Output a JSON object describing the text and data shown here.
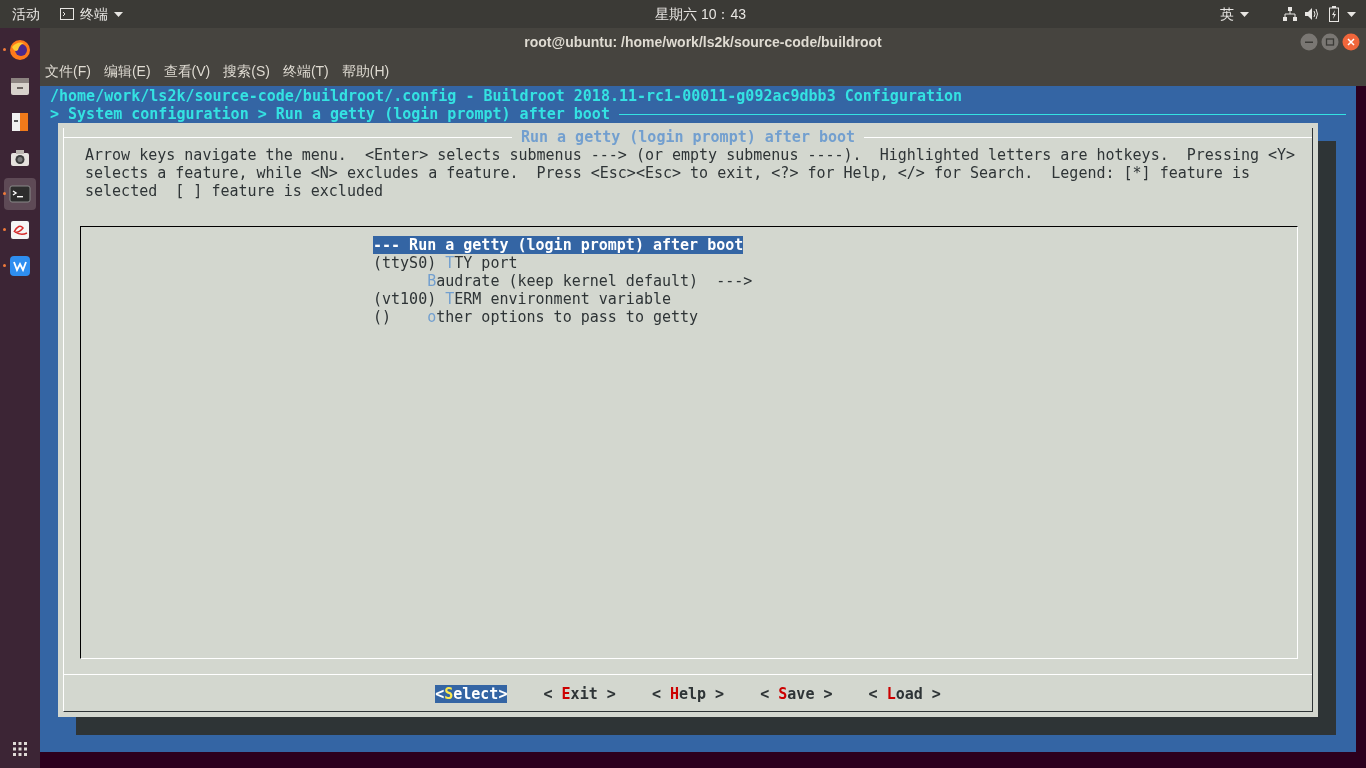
{
  "top_bar": {
    "activities": "活动",
    "app_menu": "终端",
    "clock": "星期六 10：43",
    "input_method": "英"
  },
  "dock": {
    "items": [
      {
        "kind": "firefox",
        "running": true,
        "selected": false
      },
      {
        "kind": "files",
        "running": false,
        "selected": false
      },
      {
        "kind": "office",
        "running": false,
        "selected": false
      },
      {
        "kind": "camera",
        "running": false,
        "selected": false
      },
      {
        "kind": "terminal",
        "running": true,
        "selected": true
      },
      {
        "kind": "editor",
        "running": true,
        "selected": false
      },
      {
        "kind": "writer",
        "running": true,
        "selected": false
      }
    ]
  },
  "window": {
    "title": "root@ubuntu: /home/work/ls2k/source-code/buildroot",
    "menu": [
      "文件(F)",
      "编辑(E)",
      "查看(V)",
      "搜索(S)",
      "终端(T)",
      "帮助(H)"
    ]
  },
  "terminal": {
    "header": "/home/work/ls2k/source-code/buildroot/.config - Buildroot 2018.11-rc1-00011-g092ac9dbb3 Configuration",
    "breadcrumb": "> System configuration > Run a getty (login prompt) after boot",
    "dialog": {
      "title": "Run a getty (login prompt) after boot",
      "help": "Arrow keys navigate the menu.  <Enter> selects submenus ---> (or empty submenus ----).  Highlighted letters are hotkeys.  Pressing <Y> selects a feature, while <N> excludes a feature.  Press <Esc><Esc> to exit, <?> for Help, </> for Search.  Legend: [*] feature is selected  [ ] feature is excluded",
      "items": [
        {
          "kind": "header",
          "text": "--- Run a getty (login prompt) after boot",
          "selected": true
        },
        {
          "kind": "option",
          "prefix": "(ttyS0) ",
          "hotkey": "T",
          "rest": "TY port",
          "selected": false
        },
        {
          "kind": "submenu",
          "hotkey": "B",
          "rest": "audrate (keep kernel default)  --->",
          "selected": false
        },
        {
          "kind": "option",
          "prefix": "(vt100) ",
          "hotkey": "T",
          "rest": "ERM environment variable",
          "selected": false
        },
        {
          "kind": "option",
          "prefix": "()    ",
          "hotkey": "o",
          "rest": "ther options to pass to getty",
          "selected": false
        }
      ],
      "buttons": [
        {
          "open": "<",
          "hotkey": "S",
          "rest": "elect",
          "close": ">",
          "selected": true
        },
        {
          "open": "< ",
          "hotkey": "E",
          "rest": "xit",
          "close": " >",
          "selected": false
        },
        {
          "open": "< ",
          "hotkey": "H",
          "rest": "elp",
          "close": " >",
          "selected": false
        },
        {
          "open": "< ",
          "hotkey": "S",
          "rest": "ave",
          "close": " >",
          "selected": false
        },
        {
          "open": "< ",
          "hotkey": "L",
          "rest": "oad",
          "close": " >",
          "selected": false
        }
      ]
    }
  }
}
